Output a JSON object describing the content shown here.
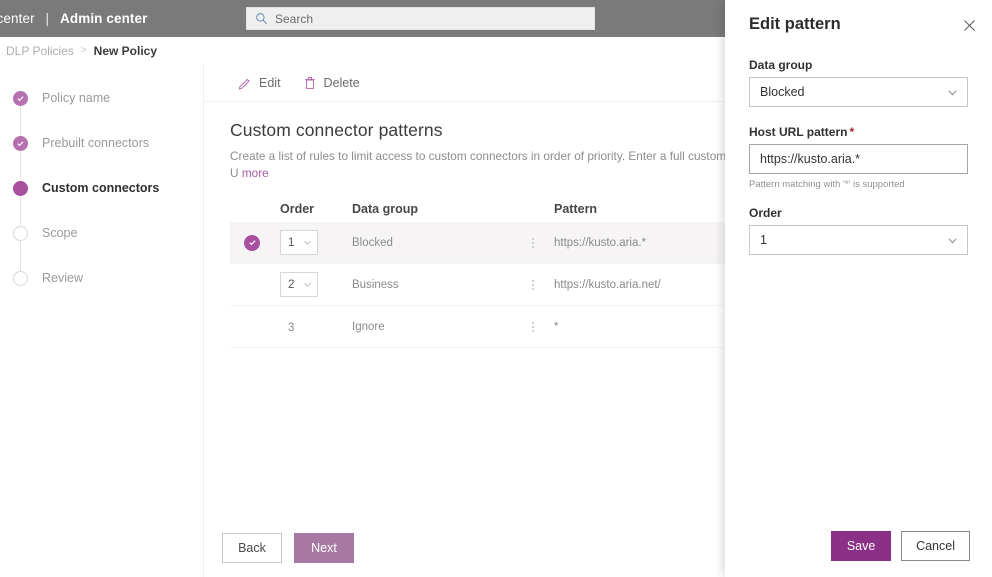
{
  "topbar": {
    "brand_truncated": "in center",
    "brand_separator": "|",
    "brand_main": "Admin center",
    "search_placeholder": "Search",
    "search_value": "",
    "search_icon": "search-icon",
    "background": "#7a7a7a"
  },
  "breadcrumb": {
    "parent": "DLP Policies",
    "separator": ">",
    "current": "New Policy"
  },
  "stepper": {
    "items": [
      {
        "label": "Policy name",
        "state": "done"
      },
      {
        "label": "Prebuilt connectors",
        "state": "done"
      },
      {
        "label": "Custom connectors",
        "state": "current"
      },
      {
        "label": "Scope",
        "state": "todo"
      },
      {
        "label": "Review",
        "state": "todo"
      }
    ]
  },
  "toolbar": {
    "edit_label": "Edit",
    "edit_icon": "pencil-icon",
    "delete_label": "Delete",
    "delete_icon": "trash-icon"
  },
  "main": {
    "title": "Custom connector patterns",
    "description": "Create a list of rules to limit access to custom connectors in order of priority. Enter a full custom connector U",
    "more_link": "more"
  },
  "table": {
    "columns": [
      "Order",
      "Data group",
      "Pattern"
    ],
    "rows": [
      {
        "order": "1",
        "order_is_select": true,
        "data_group": "Blocked",
        "pattern": "https://kusto.aria.*",
        "selected": true
      },
      {
        "order": "2",
        "order_is_select": true,
        "data_group": "Business",
        "pattern": "https://kusto.aria.net/",
        "selected": false
      },
      {
        "order": "3",
        "order_is_select": false,
        "data_group": "Ignore",
        "pattern": "*",
        "selected": false
      }
    ]
  },
  "wizard_footer": {
    "back_label": "Back",
    "next_label": "Next",
    "next_color": "#a878a4"
  },
  "panel": {
    "title": "Edit pattern",
    "close_icon": "close-icon",
    "data_group": {
      "label": "Data group",
      "value": "Blocked",
      "chevron_icon": "chevron-down-icon"
    },
    "host_url": {
      "label": "Host URL pattern",
      "required_marker": "*",
      "value": "https://kusto.aria.*",
      "hint": "Pattern matching with '*' is supported"
    },
    "order": {
      "label": "Order",
      "value": "1",
      "chevron_icon": "chevron-down-icon"
    },
    "save_label": "Save",
    "cancel_label": "Cancel",
    "save_color": "#8c2f87"
  }
}
